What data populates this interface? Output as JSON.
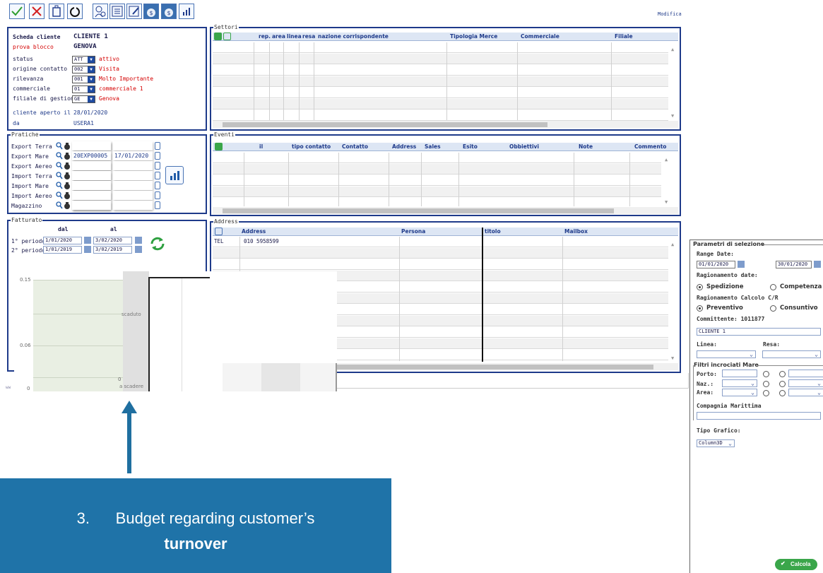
{
  "toolbar": {
    "buttons": [
      "confirm-icon",
      "cancel-icon",
      "delete-icon",
      "refresh-icon",
      "user-search-icon",
      "list-icon",
      "edit-icon",
      "money-bag-icon",
      "money-bag-icon",
      "chart-icon"
    ],
    "modifica_link": "Modifica"
  },
  "scheda": {
    "scheda_label": "Scheda cliente",
    "scheda_value": "CLIENTE 1",
    "prova_label": "prova blocco",
    "prova_value": "GENOVA",
    "fields": [
      {
        "label": "status",
        "code": "ATT",
        "desc": "attivo"
      },
      {
        "label": "origine contatto",
        "code": "002",
        "desc": "Visita"
      },
      {
        "label": "rilevanza",
        "code": "001",
        "desc": "Molto Importante"
      },
      {
        "label": "commerciale",
        "code": "01",
        "desc": "commerciale 1"
      },
      {
        "label": "filiale di gestione",
        "code": "GE",
        "desc": "Genova"
      }
    ],
    "aperto_label": "cliente aperto il",
    "aperto_value": "28/01/2020",
    "da_label": "da",
    "da_value": "USERA1"
  },
  "settori": {
    "title": "Settori",
    "columns": [
      "rep.",
      "area",
      "linea",
      "resa",
      "nazione corrispondente",
      "Tipologia Merce",
      "Commerciale",
      "Filiale"
    ]
  },
  "pratiche": {
    "title": "Pratiche",
    "rows": [
      {
        "label": "Export Terra",
        "num": "",
        "date": ""
      },
      {
        "label": "Export Mare",
        "num": "20EXP00005",
        "date": "17/01/2020"
      },
      {
        "label": "Export Aereo",
        "num": "",
        "date": ""
      },
      {
        "label": "Import Terra",
        "num": "",
        "date": ""
      },
      {
        "label": "Import Mare",
        "num": "",
        "date": ""
      },
      {
        "label": "Import Aereo",
        "num": "",
        "date": ""
      },
      {
        "label": "Magazzino",
        "num": "",
        "date": ""
      }
    ]
  },
  "eventi": {
    "title": "Eventi",
    "columns": [
      "il",
      "tipo contatto",
      "Contatto",
      "Address",
      "Sales",
      "Esito",
      "Obbiettivi",
      "Note",
      "Commento"
    ]
  },
  "fatturato": {
    "title": "Fatturato",
    "dal_label": "dal",
    "al_label": "al",
    "periods": [
      {
        "label": "1° periodo",
        "dal": "1/01/2020",
        "al": "3/02/2020"
      },
      {
        "label": "2° periodo",
        "dal": "1/01/2019",
        "al": "3/02/2019"
      }
    ]
  },
  "address": {
    "title": "Address",
    "columns": [
      "Address",
      "Persona",
      "titolo",
      "Mailbox"
    ],
    "rows": [
      {
        "type": "TEL",
        "address": "010  5958599"
      }
    ]
  },
  "chart": {
    "y_ticks": [
      "0.15",
      "0.06",
      "0"
    ],
    "labels": [
      "scaduto",
      "a scadere"
    ],
    "values": [
      "0",
      "0"
    ],
    "footer_fragment": "ww"
  },
  "params": {
    "title": "Parametri di selezione",
    "range_label": "Range Date:",
    "date_from": "01/01/2020",
    "date_to": "30/01/2020",
    "ragionamento_date_label": "Ragionamento date:",
    "spedizione": "Spedizione",
    "competenza": "Competenza",
    "ragionamento_calcolo_label": "Ragionamento Calcolo C/R",
    "preventivo": "Preventivo",
    "consuntivo": "Consuntivo",
    "committente": "Committente: 1011877",
    "cliente_value": "CLIENTE 1",
    "linea_label": "Linea:",
    "resa_label": "Resa:",
    "filtri_title": "Filtri incrociati Mare",
    "porto_label": "Porto:",
    "naz_label": "Naz.:",
    "area_label": "Area:",
    "compagnia_label": "Compagnia Marittima",
    "tipo_grafico_label": "Tipo Grafico:",
    "tipo_grafico_value": "Column3D",
    "calcola_label": "Calcola"
  },
  "caption": {
    "line1": "3.      Budget regarding customer’s",
    "line2": "turnover"
  },
  "colors": {
    "frame": "#1e3a8a",
    "accent_red": "#d40000",
    "caption_bg": "#1f73a8",
    "arrow": "#1f6fa0",
    "calcola_bg": "#3aa64a"
  }
}
